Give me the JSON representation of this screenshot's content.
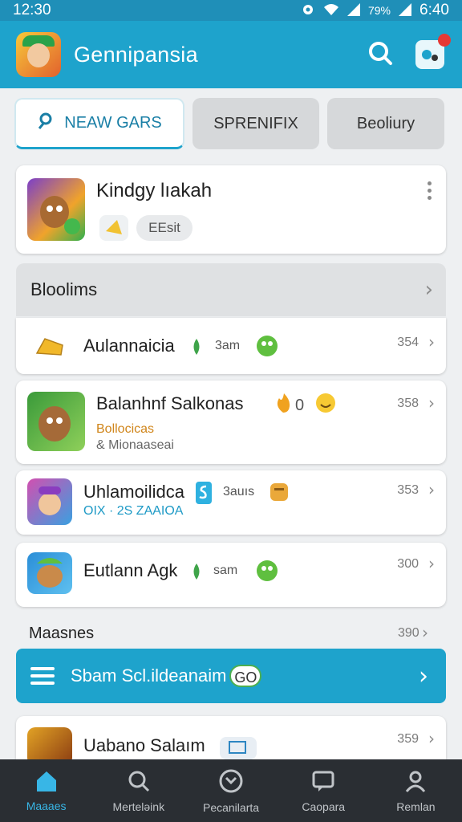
{
  "status": {
    "time": "12:30",
    "battery": "79%",
    "clock_right": "6:40"
  },
  "header": {
    "title": "Gennipansia",
    "search_icon": "search-icon",
    "msg_icon": "chat-icon",
    "accent": "#1ea3cc"
  },
  "tabs": [
    {
      "label": "NEAW GARS",
      "active": true
    },
    {
      "label": "SPRENIFIX",
      "active": false
    },
    {
      "label": "Beoliury",
      "active": false
    }
  ],
  "featured": {
    "title": "Kindgy lıakah",
    "badge": "EEsit"
  },
  "section": {
    "title": "Bloolims"
  },
  "rows": [
    {
      "title": "Aulannaicia",
      "meta": "3am",
      "count": "354"
    },
    {
      "title": "Balanhnf Salkonas",
      "meta": "0",
      "sub_orange": "Bollocicas",
      "sub_gray": "& Mionaaseai",
      "count": "358"
    },
    {
      "title": "Uhlamoilidca",
      "meta": "3auıs",
      "sub_blue": "OIX · 2S ZAAIOA",
      "count": "353"
    },
    {
      "title": "Eutlann Agk",
      "meta": "sam",
      "count": "300"
    }
  ],
  "subsection": {
    "title": "Maasnes",
    "count": "390"
  },
  "promo": {
    "label": "Sbam Scl.ildeanaim",
    "go": "GO"
  },
  "last_row": {
    "title": "Uabano Salaım",
    "count": "359"
  },
  "bottom_nav": [
    {
      "label": "Maaaes",
      "active": true
    },
    {
      "label": "Merteləink",
      "active": false
    },
    {
      "label": "Pecanilarta",
      "active": false
    },
    {
      "label": "Caopara",
      "active": false
    },
    {
      "label": "Remlan",
      "active": false
    }
  ]
}
